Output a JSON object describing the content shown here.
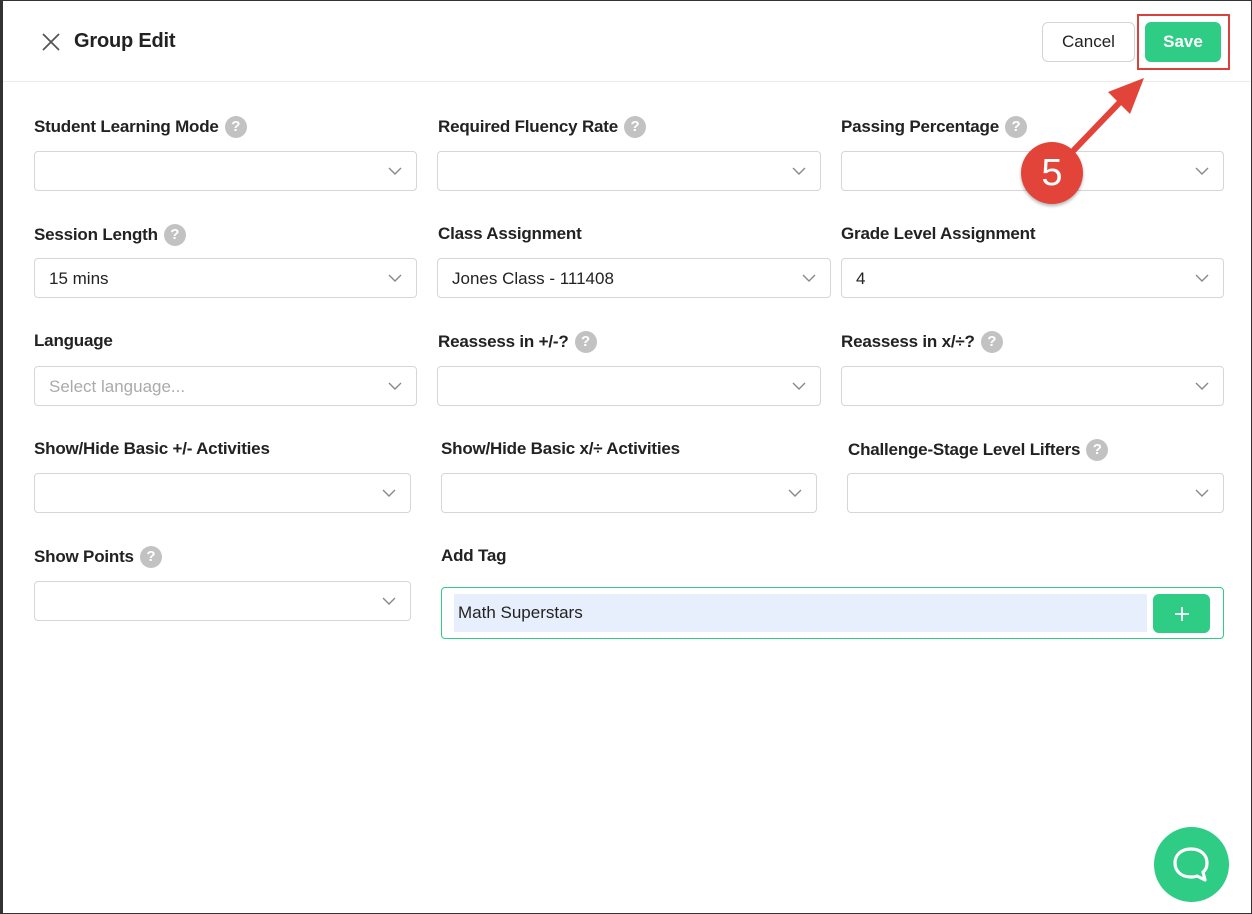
{
  "header": {
    "title": "Group Edit",
    "cancel_label": "Cancel",
    "save_label": "Save"
  },
  "annotation": {
    "step_number": "5"
  },
  "fields": {
    "student_learning_mode": {
      "label": "Student Learning Mode",
      "value": ""
    },
    "required_fluency_rate": {
      "label": "Required Fluency Rate",
      "value": ""
    },
    "passing_percentage": {
      "label": "Passing Percentage",
      "value": ""
    },
    "session_length": {
      "label": "Session Length",
      "value": "15 mins"
    },
    "class_assignment": {
      "label": "Class Assignment",
      "value": "Jones Class - 111408"
    },
    "grade_level_assignment": {
      "label": "Grade Level Assignment",
      "value": "4"
    },
    "language": {
      "label": "Language",
      "value": "",
      "placeholder": "Select language..."
    },
    "reassess_add_sub": {
      "label": "Reassess in +/-?",
      "value": ""
    },
    "reassess_mul_div": {
      "label": "Reassess in x/÷?",
      "value": ""
    },
    "show_hide_basic_add_sub": {
      "label": "Show/Hide Basic +/- Activities",
      "value": ""
    },
    "show_hide_basic_mul_div": {
      "label": "Show/Hide Basic x/÷ Activities",
      "value": ""
    },
    "challenge_stage_level_lifters": {
      "label": "Challenge-Stage Level Lifters",
      "value": ""
    },
    "show_points": {
      "label": "Show Points",
      "value": ""
    },
    "add_tag": {
      "label": "Add Tag",
      "value": "Math Superstars"
    }
  },
  "help_icon_glyph": "?",
  "icons": [
    "close-icon",
    "help-icon",
    "chevron-down-icon",
    "plus-icon",
    "chat-icon"
  ],
  "colors": {
    "accent": "#2ecc84",
    "annotation_red": "#e2443a",
    "tag_input_bg": "#e8effc"
  }
}
